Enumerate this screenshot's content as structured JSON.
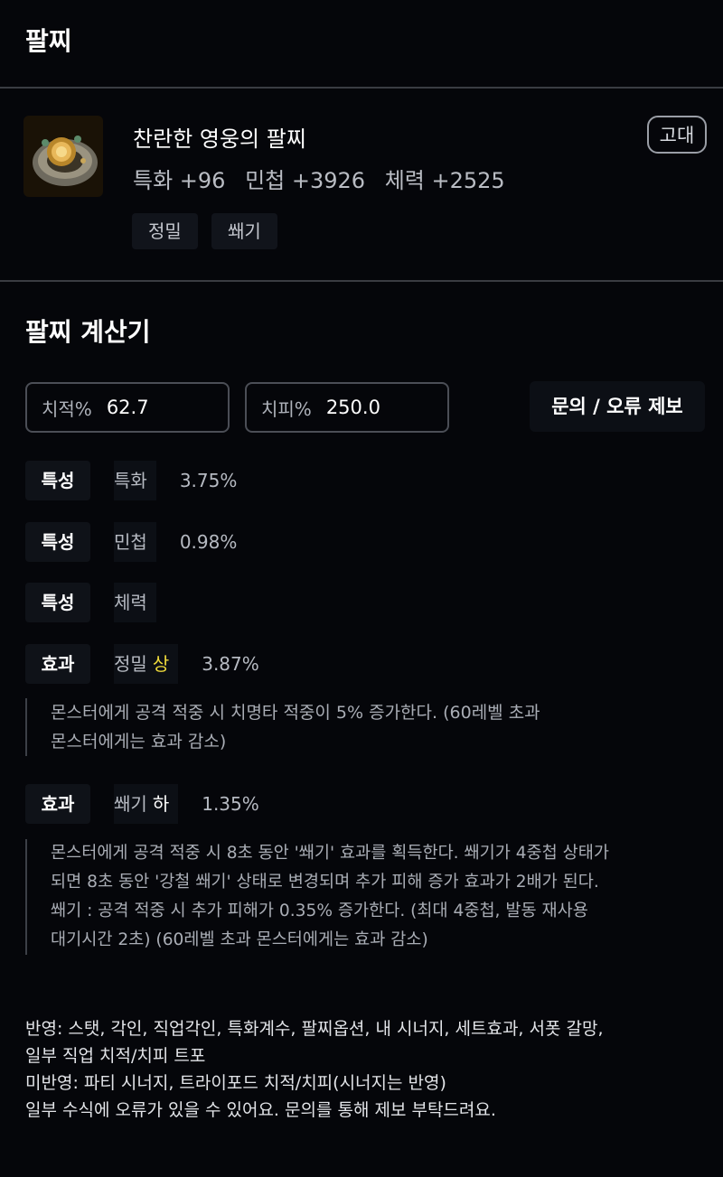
{
  "header": {
    "title": "팔찌"
  },
  "item": {
    "name": "찬란한 영웅의 팔찌",
    "grade": "고대",
    "stats": [
      "특화 +96",
      "민첩 +3926",
      "체력 +2525"
    ],
    "tags": [
      "정밀",
      "쐐기"
    ]
  },
  "calculator": {
    "title": "팔찌 계산기",
    "crit_rate": {
      "label": "치적%",
      "value": "62.7"
    },
    "crit_dmg": {
      "label": "치피%",
      "value": "250.0"
    },
    "report_label": "문의 / 오류 제보",
    "rows": [
      {
        "type": "특성",
        "name": "특화",
        "grade": "",
        "value": "3.75%"
      },
      {
        "type": "특성",
        "name": "민첩",
        "grade": "",
        "value": "0.98%"
      },
      {
        "type": "특성",
        "name": "체력",
        "grade": "",
        "value": ""
      },
      {
        "type": "효과",
        "name": "정밀",
        "grade": "상",
        "value": "3.87%",
        "desc": [
          "몬스터에게 공격 적중 시 치명타 적중이 5% 증가한다. (60레벨 초과",
          "몬스터에게는 효과 감소)"
        ]
      },
      {
        "type": "효과",
        "name": "쐐기",
        "grade": "하",
        "value": "1.35%",
        "desc": [
          "몬스터에게 공격 적중 시 8초 동안 '쐐기' 효과를 획득한다. 쐐기가 4중첩 상태가",
          "되면 8초 동안 '강철 쐐기' 상태로 변경되며 추가 피해 증가 효과가 2배가 된다.",
          "쐐기 : 공격 적중 시 추가 피해가 0.35% 증가한다. (최대 4중첩, 발동 재사용",
          "대기시간 2초) (60레벨 초과 몬스터에게는 효과 감소)"
        ]
      }
    ]
  },
  "footer": {
    "lines": [
      "반영: 스탯, 각인, 직업각인, 특화계수, 팔찌옵션, 내 시너지, 세트효과, 서폿 갈망,",
      "일부 직업 치적/치피 트포",
      "미반영: 파티 시너지, 트라이포드 치적/치피(시너지는 반영)",
      "일부 수식에 오류가 있을 수 있어요. 문의를 통해 제보 부탁드려요."
    ]
  },
  "colors": {
    "background": "#05060a",
    "grade_high": "#f2dd3b",
    "divider": "#3a3c42"
  },
  "icons": {
    "item_image": "bracelet-icon"
  }
}
